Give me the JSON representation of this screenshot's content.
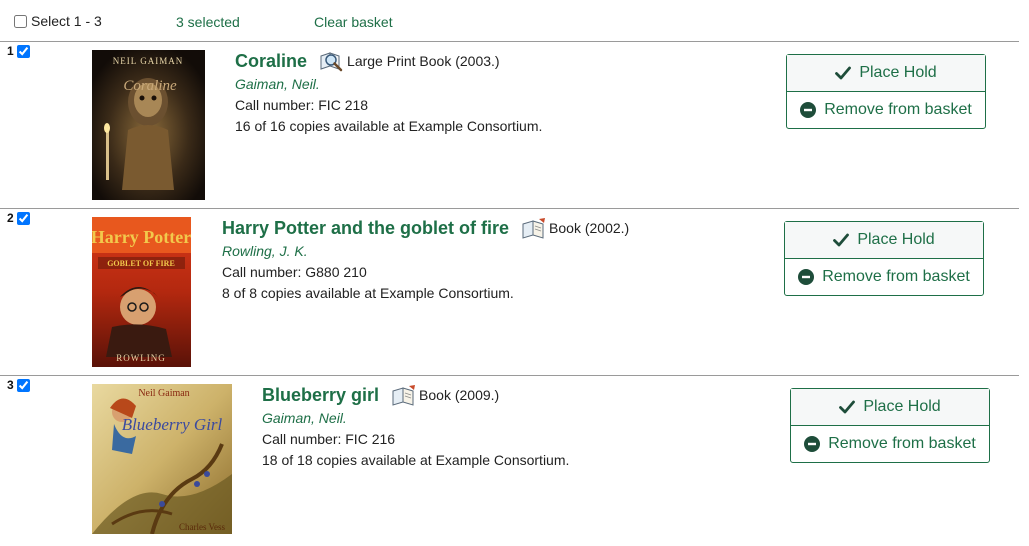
{
  "toolbar": {
    "select_label": "Select 1 - 3",
    "selected_count": "3 selected",
    "clear_label": "Clear basket"
  },
  "items": [
    {
      "number": "1",
      "title": "Coraline",
      "format": "Large Print Book (2003.)",
      "format_icon": "magnifier-book-icon",
      "author": "Gaiman, Neil.",
      "call_number": "Call number: FIC 218",
      "availability": "16 of 16 copies available at Example Consortium.",
      "cover_text_top": "NEIL GAIMAN",
      "cover_text_title": "Coraline",
      "place_hold": "Place Hold",
      "remove": "Remove from basket"
    },
    {
      "number": "2",
      "title": "Harry Potter and the goblet of fire",
      "format": "Book (2002.)",
      "format_icon": "book-icon",
      "author": "Rowling, J. K.",
      "call_number": "Call number: G880 210",
      "availability": "8 of 8 copies available at Example Consortium.",
      "cover_text_top": "Harry Potter",
      "cover_text_title": "GOBLET OF FIRE",
      "cover_text_bottom": "ROWLING",
      "place_hold": "Place Hold",
      "remove": "Remove from basket"
    },
    {
      "number": "3",
      "title": "Blueberry girl",
      "format": "Book (2009.)",
      "format_icon": "book-icon",
      "author": "Gaiman, Neil.",
      "call_number": "Call number: FIC 216",
      "availability": "18 of 18 copies available at Example Consortium.",
      "cover_text_top": "Neil Gaiman",
      "cover_text_title": "Blueberry Girl",
      "cover_text_bottom": "Charles Vess",
      "place_hold": "Place Hold",
      "remove": "Remove from basket"
    }
  ],
  "colors": {
    "accent": "#1e6f47",
    "divider": "#9a9a9a"
  }
}
